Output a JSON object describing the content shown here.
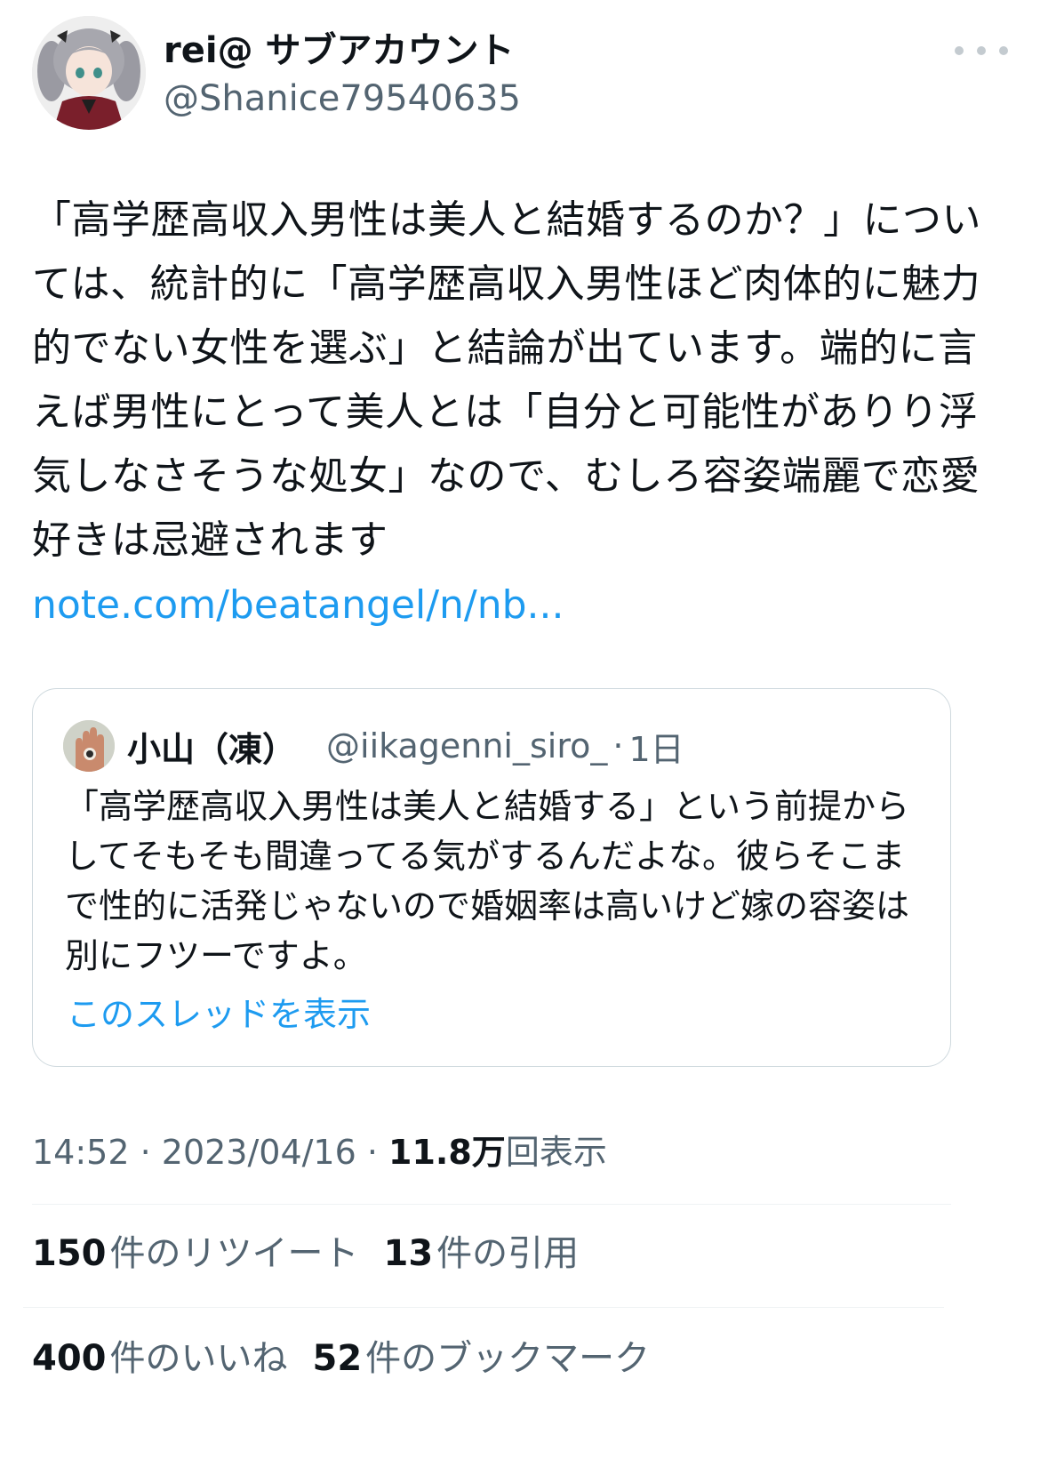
{
  "author": {
    "name": "rei@ サブアカウント",
    "handle": "@Shanice79540635"
  },
  "tweet": {
    "text": "「高学歴高収入男性は美人と結婚するのか？」については、統計的に「高学歴高収入男性ほど肉体的に魅力的でない女性を選ぶ」と結論が出ています。端的に言えば男性にとって美人とは「自分と可能性がありり浮気しなさそうな処女」なので、むしろ容姿端麗で恋愛好きは忌避されます",
    "link": "note.com/beatangel/n/nb..."
  },
  "quote": {
    "name": "小山（凍）",
    "handle": "@iikagenni_siro_",
    "separator": "·",
    "time": "1日",
    "text": "「高学歴高収入男性は美人と結婚する」という前提からしてそもそも間違ってる気がするんだよな。彼らそこまで性的に活発じゃないので婚姻率は高いけど嫁の容姿は別にフツーですよ。",
    "thread_link": "このスレッドを表示"
  },
  "meta": {
    "time": "14:52",
    "sep1": " · ",
    "date": "2023/04/16",
    "sep2": " · ",
    "views_count": "11.8万",
    "views_label": "回表示"
  },
  "stats": {
    "retweets": {
      "count": "150",
      "label": "件のリツイート"
    },
    "quotes": {
      "count": "13",
      "label": "件の引用"
    },
    "likes": {
      "count": "400",
      "label": "件のいいね"
    },
    "bookmarks": {
      "count": "52",
      "label": "件のブックマーク"
    }
  },
  "colors": {
    "link": "#1d9bf0",
    "secondary_text": "#536471",
    "border": "#cfd9de"
  }
}
